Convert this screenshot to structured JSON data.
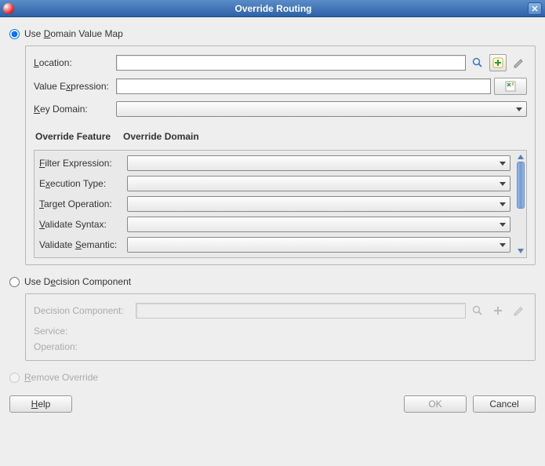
{
  "title": "Override Routing",
  "radio1_label_pre": "Use ",
  "radio1_label_u": "D",
  "radio1_label_post": "omain Value Map",
  "dvm": {
    "location_pre": "",
    "location_u": "L",
    "location_post": "ocation:",
    "value_pre": "Value E",
    "value_u": "x",
    "value_post": "pression:",
    "key_pre": "",
    "key_u": "K",
    "key_post": "ey Domain:",
    "hdr_feature": "Override Feature",
    "hdr_domain": "Override Domain",
    "filter_pre": "",
    "filter_u": "F",
    "filter_post": "ilter Expression:",
    "exec_pre": "E",
    "exec_u": "x",
    "exec_post": "ecution Type:",
    "target_pre": "",
    "target_u": "T",
    "target_post": "arget Operation:",
    "valsyn_pre": "",
    "valsyn_u": "V",
    "valsyn_post": "alidate Syntax:",
    "valsem_pre": "Validate ",
    "valsem_u": "S",
    "valsem_post": "emantic:"
  },
  "radio2_label_pre": "Use D",
  "radio2_label_u": "e",
  "radio2_label_post": "cision Component",
  "dc": {
    "comp": "Decision Component:",
    "service": "Service:",
    "operation": "Operation:"
  },
  "remove_pre": "",
  "remove_u": "R",
  "remove_post": "emove Override",
  "buttons": {
    "help_u": "H",
    "help_post": "elp",
    "ok": "OK",
    "cancel": "Cancel"
  }
}
